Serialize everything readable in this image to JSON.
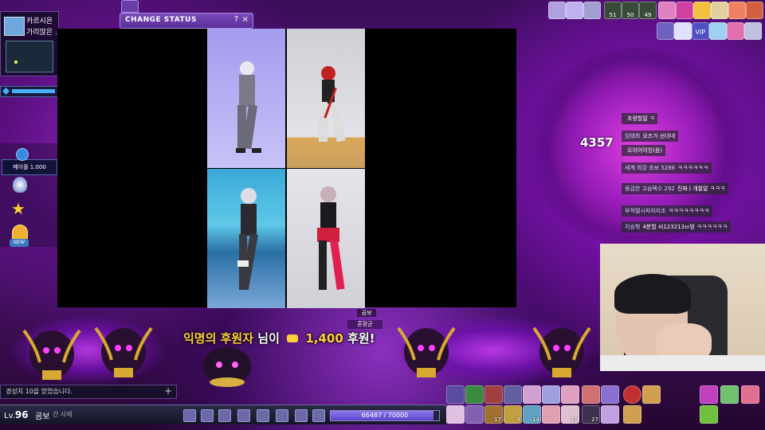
{
  "minimap": {
    "line1": "카르시온",
    "line2": "가리앉은 ..."
  },
  "left_status": {
    "text": "메이플 1.000"
  },
  "change_status": {
    "title": "CHANGE STATUS",
    "help": "?",
    "close": "×"
  },
  "hud_top": {
    "counts": [
      "51",
      "50",
      "49"
    ],
    "vip": "VIP"
  },
  "damage_number": "4357",
  "chat": {
    "lines": [
      {
        "user": "",
        "text": "초량할말 ㅋ"
      },
      {
        "user": "임태희",
        "text": "오즈가 선녀네"
      },
      {
        "user": "",
        "text": "오이어이잉(음)"
      },
      {
        "user": "세계 최강 초보 5288",
        "text": "ㅋㅋㅋㅋㅋㅋ"
      },
      {
        "user": "용감한 고슴택수 292",
        "text": "진짜ㅏ개찰말 ㅋㅋㅋ"
      },
      {
        "user": "부적텔시피자지조",
        "text": "ㅋㅋㅋㅋㅋㅋㅋㅋ"
      },
      {
        "user": "지승혁",
        "text": "4분할 씨123213ㅂ밤 ㅋㅋㅋㅋㅋㅋ"
      }
    ]
  },
  "donation": {
    "name": "익명의 후원자",
    "suffix": "님이",
    "amount": "1,400",
    "suffix2": "후원!"
  },
  "tags": {
    "gom": "곰보",
    "jang": "혼장군"
  },
  "chat_input": {
    "text": "경성치 10을 얻었습니다.",
    "plus": "+"
  },
  "player": {
    "lv_prefix": "Lv.",
    "level": "96",
    "name": "곰보",
    "job": "간 사제"
  },
  "exp": {
    "text": "66487 / 70000",
    "fraction": 0.95
  },
  "quickslot_counts": [
    "17",
    "9",
    "14",
    "11",
    "27"
  ],
  "colors": {
    "accent": "#7a4ab8",
    "gold": "#ffd03a",
    "bg": "#3b0d5a"
  }
}
